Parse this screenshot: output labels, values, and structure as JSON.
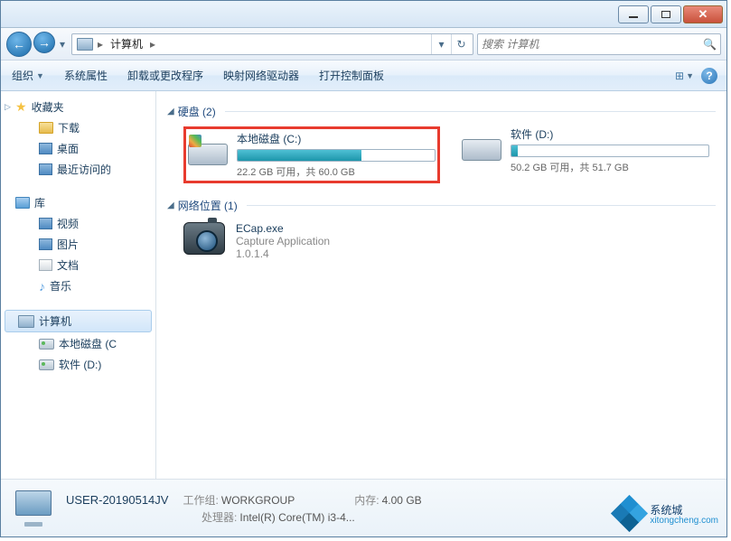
{
  "titlebar": {
    "window_title": ""
  },
  "nav": {
    "back": "←",
    "fwd": "→",
    "root_label": "计算机",
    "crumb_sep": "▸",
    "refresh": "↻",
    "dropdown": "▾"
  },
  "search": {
    "placeholder": "搜索 计算机",
    "icon": "🔍"
  },
  "toolbar": {
    "organize": "组织",
    "sys_props": "系统属性",
    "uninstall": "卸载或更改程序",
    "map_drive": "映射网络驱动器",
    "control_panel": "打开控制面板",
    "help": "?"
  },
  "sidebar": {
    "favorites": "收藏夹",
    "downloads": "下载",
    "desktop": "桌面",
    "recent": "最近访问的",
    "libraries": "库",
    "videos": "视频",
    "pictures": "图片",
    "documents": "文档",
    "music": "音乐",
    "computer": "计算机",
    "localdisk_c": "本地磁盘 (C",
    "software_d": "软件 (D:)"
  },
  "content": {
    "hdd_group": "硬盘 (2)",
    "drives": [
      {
        "label": "本地磁盘 (C:)",
        "stats": "22.2 GB 可用，共 60.0 GB",
        "fill_pct": 63,
        "highlighted": true
      },
      {
        "label": "软件 (D:)",
        "stats": "50.2 GB 可用，共 51.7 GB",
        "fill_pct": 3,
        "highlighted": false
      }
    ],
    "net_group": "网络位置 (1)",
    "net_item": {
      "name": "ECap.exe",
      "desc": "Capture Application",
      "ver": "1.0.1.4"
    }
  },
  "details": {
    "name": "USER-20190514JV",
    "workgroup_k": "工作组:",
    "workgroup_v": "WORKGROUP",
    "mem_k": "内存:",
    "mem_v": "4.00 GB",
    "cpu_k": "处理器:",
    "cpu_v": "Intel(R) Core(TM) i3-4..."
  },
  "watermark": {
    "text": "系统城",
    "sub": "xitongcheng.com"
  }
}
